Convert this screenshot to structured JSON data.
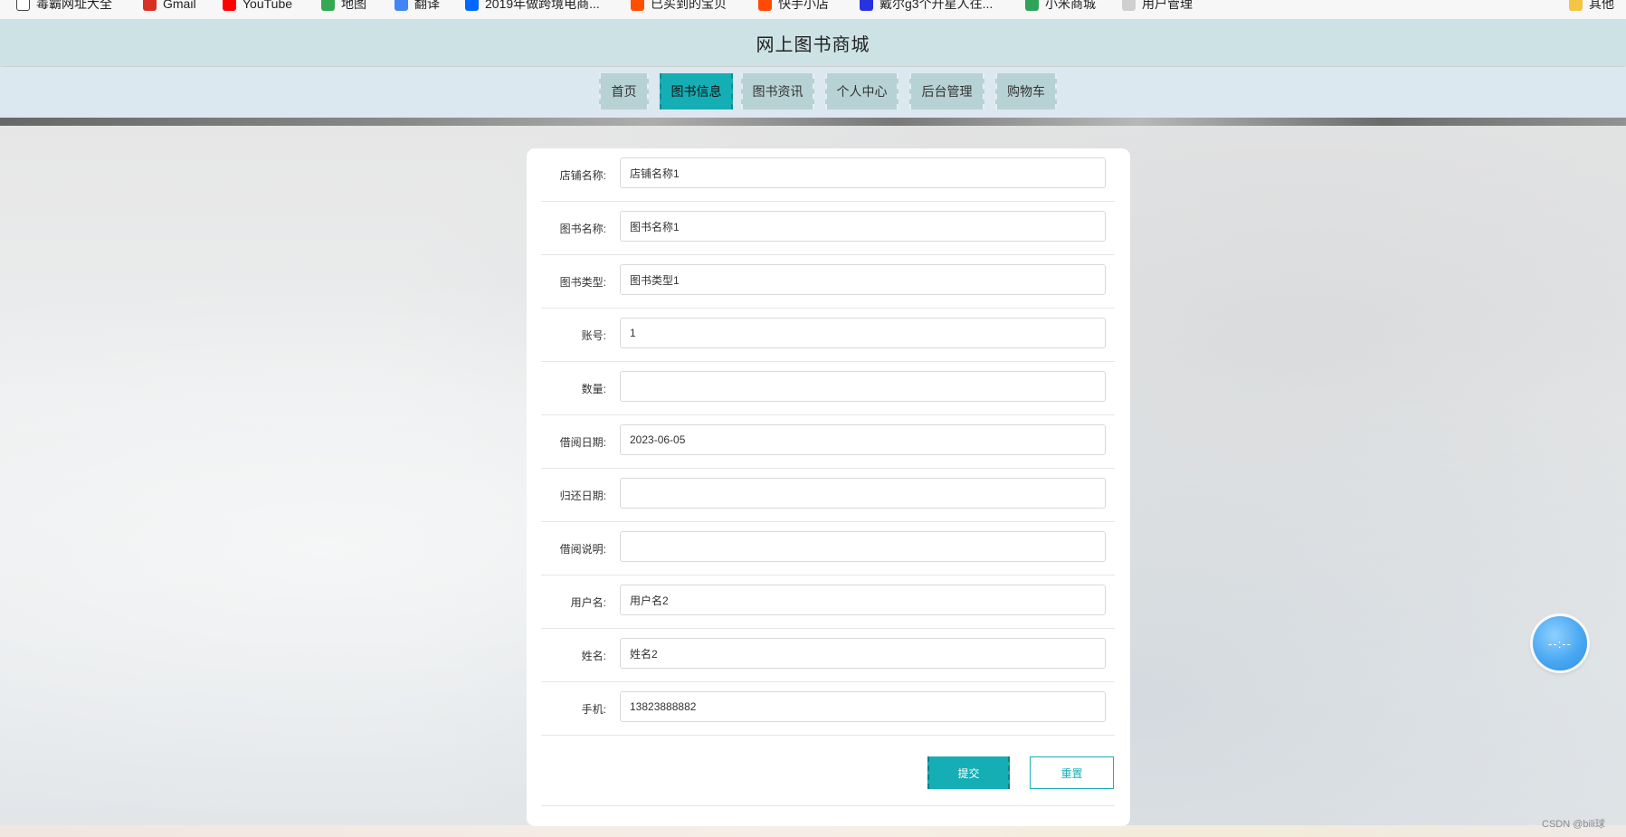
{
  "bookmarks": [
    {
      "label": "毒霸网址大全",
      "icon": "page-icon",
      "color": "#ffffff"
    },
    {
      "label": "Gmail",
      "icon": "gmail-icon",
      "color": "#d93025"
    },
    {
      "label": "YouTube",
      "icon": "youtube-icon",
      "color": "#ff0000"
    },
    {
      "label": "地图",
      "icon": "maps-icon",
      "color": "#34a853"
    },
    {
      "label": "翻译",
      "icon": "translate-icon",
      "color": "#4285f4"
    },
    {
      "label": "2019年做跨境电商...",
      "icon": "zhihu-icon",
      "color": "#0066ff"
    },
    {
      "label": "已买到的宝贝",
      "icon": "taobao-icon",
      "color": "#ff5000"
    },
    {
      "label": "快手小店",
      "icon": "kuaishou-icon",
      "color": "#ff4906"
    },
    {
      "label": "戴尔g3个升星人往...",
      "icon": "baidu-icon",
      "color": "#2932e1"
    },
    {
      "label": "小米商城",
      "icon": "mi-icon",
      "color": "#2fa35a"
    },
    {
      "label": "用户管理",
      "icon": "bee-icon",
      "color": "#888888"
    },
    {
      "label": "其他",
      "icon": "folder-icon",
      "color": "#f4c542"
    }
  ],
  "header": {
    "title": "网上图书商城"
  },
  "nav": {
    "items": [
      {
        "label": "首页",
        "active": false
      },
      {
        "label": "图书信息",
        "active": true
      },
      {
        "label": "图书资讯",
        "active": false
      },
      {
        "label": "个人中心",
        "active": false
      },
      {
        "label": "后台管理",
        "active": false
      },
      {
        "label": "购物车",
        "active": false
      }
    ]
  },
  "form": {
    "fields": [
      {
        "label": "店铺名称:",
        "value": "店铺名称1"
      },
      {
        "label": "图书名称:",
        "value": "图书名称1"
      },
      {
        "label": "图书类型:",
        "value": "图书类型1"
      },
      {
        "label": "账号:",
        "value": "1"
      },
      {
        "label": "数量:",
        "value": ""
      },
      {
        "label": "借阅日期:",
        "value": "2023-06-05"
      },
      {
        "label": "归还日期:",
        "value": ""
      },
      {
        "label": "借阅说明:",
        "value": ""
      },
      {
        "label": "用户名:",
        "value": "用户名2"
      },
      {
        "label": "姓名:",
        "value": "姓名2"
      },
      {
        "label": "手机:",
        "value": "13823888882"
      }
    ],
    "submit_label": "提交",
    "reset_label": "重置"
  },
  "widget": {
    "text": "--:--"
  },
  "watermark": "CSDN @bili球",
  "colors": {
    "accent": "#16aeb5",
    "header_bg": "#cde2e4",
    "nav_bg": "#dce8ef",
    "nav_item_bg": "#b7d2d4"
  }
}
